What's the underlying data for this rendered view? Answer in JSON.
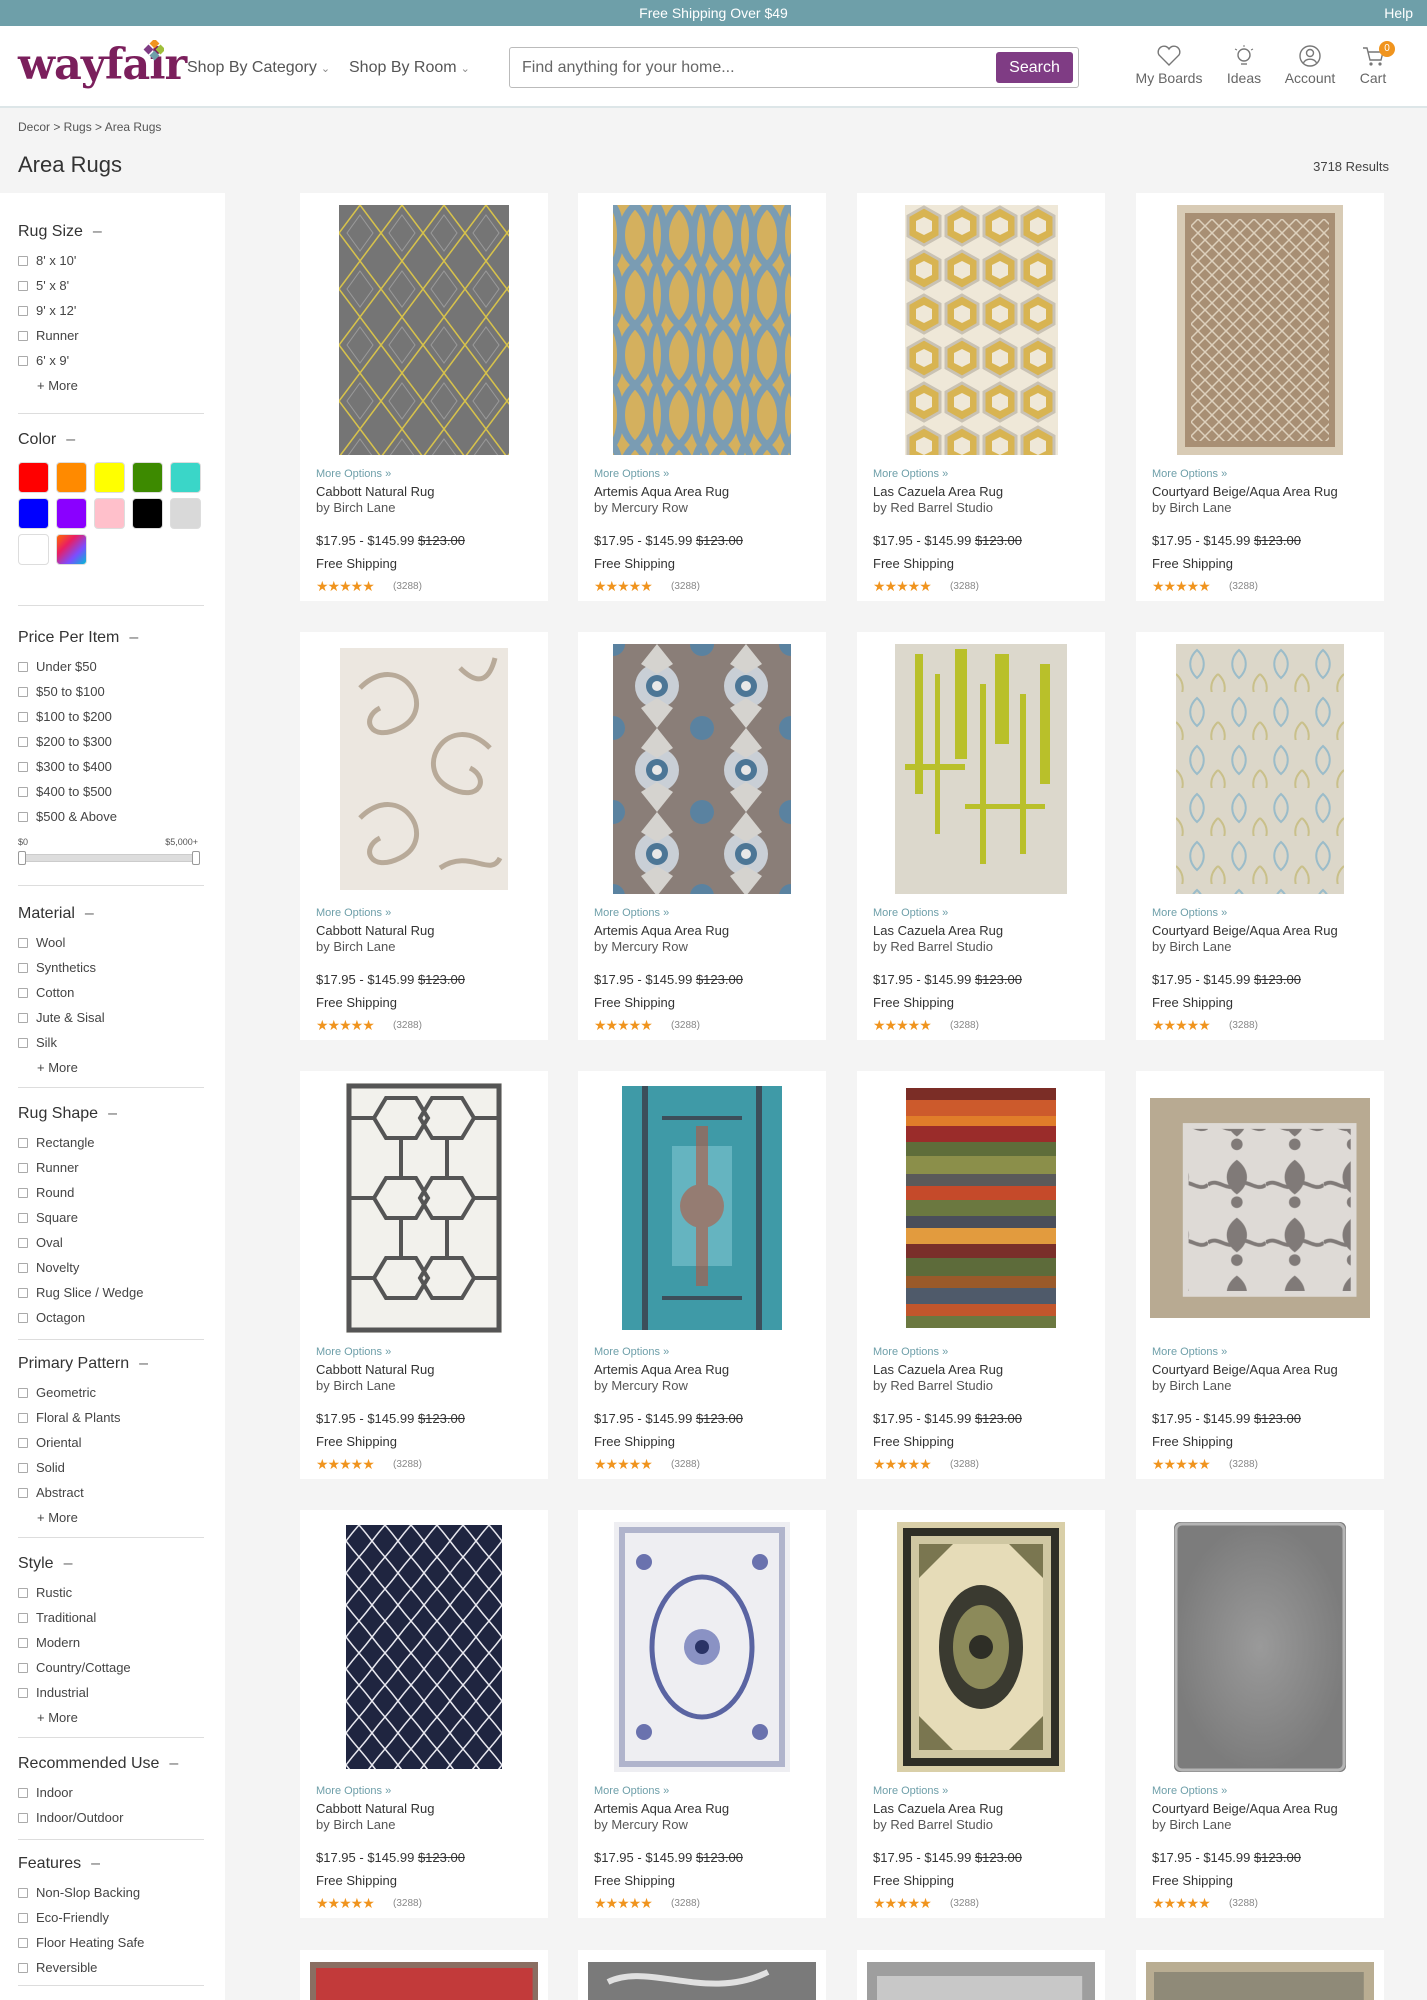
{
  "topbar": {
    "promo": "Free Shipping Over $49",
    "help": "Help"
  },
  "header": {
    "logo": "wayfair",
    "nav": [
      {
        "label": "Shop By Category"
      },
      {
        "label": "Shop By Room"
      }
    ],
    "search": {
      "placeholder": "Find anything for your home...",
      "button": "Search"
    },
    "icons": [
      {
        "label": "My Boards",
        "icon": "heart-icon"
      },
      {
        "label": "Ideas",
        "icon": "lightbulb-icon"
      },
      {
        "label": "Account",
        "icon": "user-icon"
      },
      {
        "label": "Cart",
        "icon": "cart-icon",
        "count": "0"
      }
    ]
  },
  "breadcrumb": "Decor > Rugs > Area Rugs",
  "page_title": "Area Rugs",
  "results": "3718 Results",
  "filters": {
    "rug_size": {
      "title": "Rug Size",
      "collapse": "–",
      "options": [
        "8' x 10'",
        "5' x 8'",
        "9' x 12'",
        "Runner",
        "6' x 9'"
      ],
      "more": "+ More"
    },
    "color": {
      "title": "Color",
      "collapse": "–",
      "swatches": [
        "#ff0000",
        "#ff8a00",
        "#ffff00",
        "#3d8a00",
        "#3ad6c8",
        "#0000ff",
        "#8a00ff",
        "#ffc0cb",
        "#000000",
        "#d9d9d9",
        "#ffffff",
        "multicolor"
      ]
    },
    "price": {
      "title": "Price Per Item",
      "collapse": "–",
      "options": [
        "Under $50",
        "$50 to $100",
        "$100 to $200",
        "$200 to $300",
        "$300 to $400",
        "$400 to $500",
        "$500 & Above"
      ],
      "range_min": "$0",
      "range_max": "$5,000+"
    },
    "material": {
      "title": "Material",
      "collapse": "–",
      "options": [
        "Wool",
        "Synthetics",
        "Cotton",
        "Jute & Sisal",
        "Silk"
      ],
      "more": "+ More"
    },
    "shape": {
      "title": "Rug Shape",
      "collapse": "–",
      "options": [
        "Rectangle",
        "Runner",
        "Round",
        "Square",
        "Oval",
        "Novelty",
        "Rug Slice / Wedge",
        "Octagon"
      ]
    },
    "pattern": {
      "title": "Primary Pattern",
      "collapse": "–",
      "options": [
        "Geometric",
        "Floral & Plants",
        "Oriental",
        "Solid",
        "Abstract"
      ],
      "more": "+ More"
    },
    "style": {
      "title": "Style",
      "collapse": "–",
      "options": [
        "Rustic",
        "Traditional",
        "Modern",
        "Country/Cottage",
        "Industrial"
      ],
      "more": "+ More"
    },
    "use": {
      "title": "Recommended Use",
      "collapse": "–",
      "options": [
        "Indoor",
        "Indoor/Outdoor"
      ]
    },
    "features": {
      "title": "Features",
      "collapse": "–",
      "options": [
        "Non-Slop Backing",
        "Eco-Friendly",
        "Floor Heating Safe",
        "Reversible"
      ]
    }
  },
  "product_text": {
    "more_options": "More Options »",
    "price": "$17.95 - $145.99",
    "old_price": "$123.00",
    "shipping": "Free Shipping",
    "stars": "★★★★★",
    "reviews": "(3288)",
    "rating": 5
  },
  "products": [
    {
      "name": "Cabbott Natural Rug",
      "brand": "by Birch Lane"
    },
    {
      "name": "Artemis Aqua Area Rug",
      "brand": "by Mercury Row"
    },
    {
      "name": "Las Cazuela Area Rug",
      "brand": "by Red Barrel Studio"
    },
    {
      "name": "Courtyard Beige/Aqua Area Rug",
      "brand": "by Birch Lane"
    }
  ],
  "colors": {
    "accent": "#7f3c84",
    "topbar": "#6e9fa9",
    "star": "#f0941e",
    "logo": "#7b1f5c"
  }
}
